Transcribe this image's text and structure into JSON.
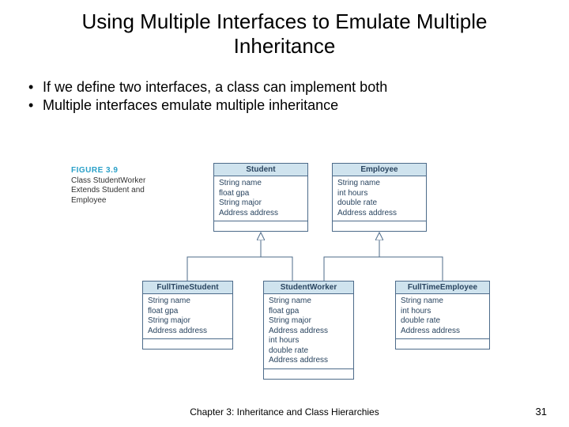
{
  "title": "Using Multiple Interfaces to Emulate Multiple Inheritance",
  "bullets": [
    "If we define two interfaces, a class can implement both",
    "Multiple interfaces emulate multiple inheritance"
  ],
  "figure": {
    "number": "FIGURE 3.9",
    "caption_line1": "Class StudentWorker",
    "caption_line2": "Extends Student and",
    "caption_line3": "Employee"
  },
  "boxes": {
    "student": {
      "name": "Student",
      "attrs": [
        "String name",
        "float gpa",
        "String major",
        "Address address"
      ]
    },
    "employee": {
      "name": "Employee",
      "attrs": [
        "String name",
        "int hours",
        "double rate",
        "Address address"
      ]
    },
    "fulltimestudent": {
      "name": "FullTimeStudent",
      "attrs": [
        "String name",
        "float gpa",
        "String major",
        "Address address"
      ]
    },
    "studentworker": {
      "name": "StudentWorker",
      "attrs": [
        "String name",
        "float gpa",
        "String major",
        "Address address",
        "int hours",
        "double rate",
        "Address address"
      ]
    },
    "fulltimeemployee": {
      "name": "FullTimeEmployee",
      "attrs": [
        "String name",
        "int hours",
        "double rate",
        "Address address"
      ]
    }
  },
  "footer": {
    "center": "Chapter 3: Inheritance and Class Hierarchies",
    "page": "31"
  }
}
